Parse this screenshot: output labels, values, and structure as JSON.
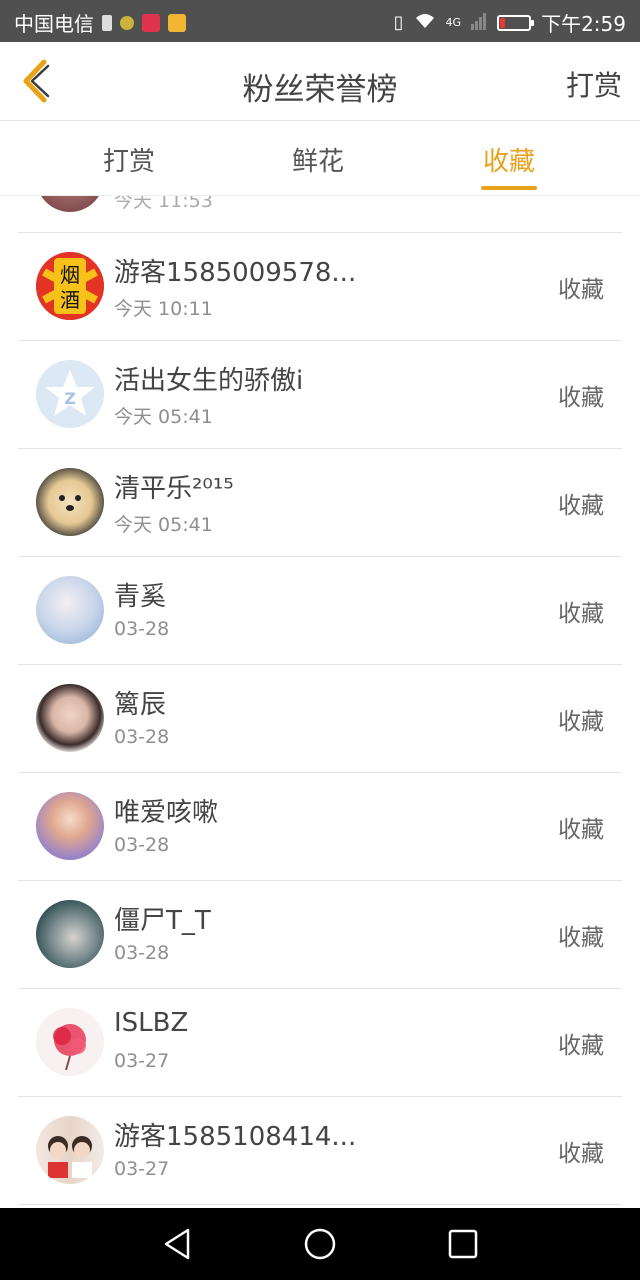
{
  "status_bar": {
    "carrier": "中国电信",
    "time": "下午2:59",
    "signal_label": "4G",
    "battery_level": 0.15,
    "battery_color": "#e53935"
  },
  "header": {
    "title": "粉丝荣誉榜",
    "right_label": "打赏",
    "back_icon": "chevron-left-icon"
  },
  "tabs": [
    {
      "label": "打赏",
      "active": false
    },
    {
      "label": "鲜花",
      "active": false
    },
    {
      "label": "收藏",
      "active": true
    }
  ],
  "accent_color": "#e6a21a",
  "list": {
    "partial_top_item_time": "今天 11:53",
    "items": [
      {
        "name": "游客1585009578...",
        "time": "今天 10:11",
        "action": "收藏",
        "avatar": "yanjiu-avatar"
      },
      {
        "name": "活出女生的骄傲i",
        "time": "今天 05:41",
        "action": "收藏",
        "avatar": "default-star-avatar"
      },
      {
        "name": "清平乐²⁰¹⁵",
        "time": "今天 05:41",
        "action": "收藏",
        "avatar": "dog-avatar"
      },
      {
        "name": "青奚",
        "time": "03-28",
        "action": "收藏",
        "avatar": "anime-girl-avatar"
      },
      {
        "name": "篱辰",
        "time": "03-28",
        "action": "收藏",
        "avatar": "man-portrait-avatar"
      },
      {
        "name": "唯爱咳嗽",
        "time": "03-28",
        "action": "收藏",
        "avatar": "anime-art-avatar"
      },
      {
        "name": "僵尸T_T",
        "time": "03-28",
        "action": "收藏",
        "avatar": "dark-hair-avatar"
      },
      {
        "name": "ISLBZ",
        "time": "03-27",
        "action": "收藏",
        "avatar": "red-flower-avatar"
      },
      {
        "name": "游客1585108414...",
        "time": "03-27",
        "action": "收藏",
        "avatar": "couple-avatar"
      }
    ]
  },
  "nav_bar": {
    "back": "triangle-back-icon",
    "home": "circle-home-icon",
    "recent": "square-recent-icon"
  }
}
